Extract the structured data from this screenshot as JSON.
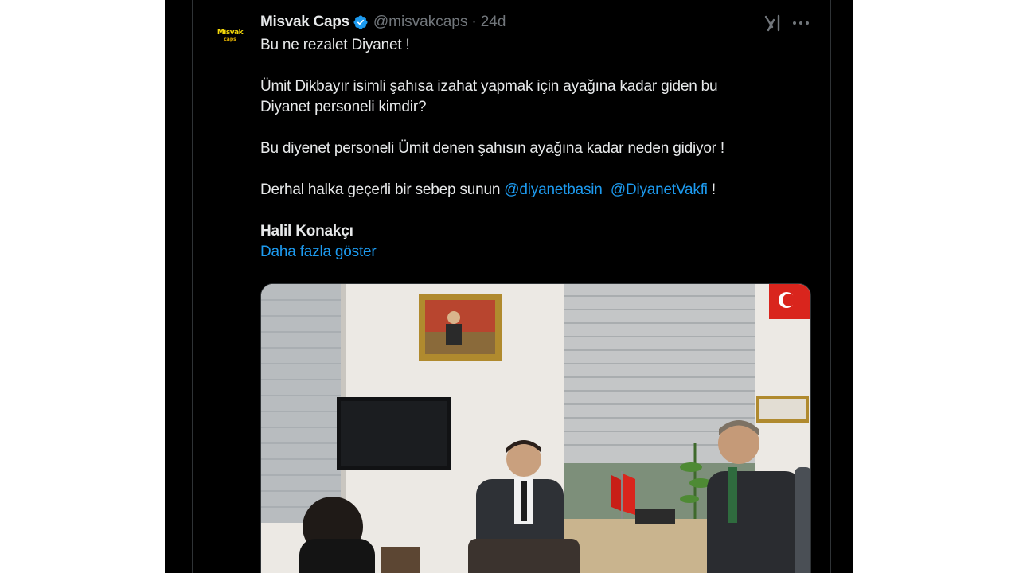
{
  "tweet": {
    "display_name": "Misvak Caps",
    "handle": "@misvakcaps",
    "separator": "·",
    "time": "24d",
    "avatar_text_top": "Misvak",
    "avatar_text_bottom": "caps",
    "lines": {
      "l1": "Bu ne rezalet Diyanet !",
      "l2a": "Ümit Dikbayır isimli şahısa izahat yapmak için ayağına kadar giden bu",
      "l2b": "Diyanet personeli kimdir?",
      "l3": "Bu diyenet personeli Ümit denen şahısın ayağına kadar neden gidiyor !",
      "l4_prefix": "Derhal halka geçerli bir sebep sunun ",
      "mention1": "@diyanetbasin",
      "mention2": "@DiyanetVakfi",
      "l4_suffix": " !",
      "signature": "Halil Konakçı"
    },
    "show_more": "Daha fazla göster"
  },
  "icons": {
    "verified": "verified-badge-icon",
    "grok": "grok-icon",
    "more": "more-options-icon"
  },
  "colors": {
    "background": "#000000",
    "text": "#e7e9ea",
    "muted": "#71767b",
    "link": "#1d9bf0",
    "border": "#2f3336"
  }
}
